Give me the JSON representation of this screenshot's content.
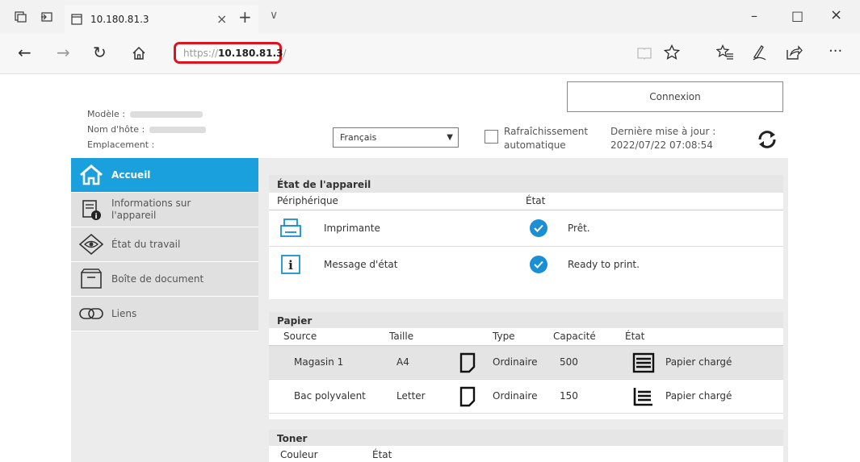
{
  "browser": {
    "tab_title": "10.180.81.3",
    "tab_close": "×",
    "new_tab": "+",
    "tab_menu": "∨",
    "minimize": "–",
    "maximize": "□",
    "close": "×",
    "back": "←",
    "forward": "→",
    "reload": "↻",
    "url_prefix": "https://",
    "url_host": "10.180.81.3",
    "url_suffix": "/",
    "more": "···"
  },
  "header": {
    "model_label": "Modèle :",
    "hostname_label": "Nom d'hôte :",
    "location_label": "Emplacement :",
    "login_button": "Connexion",
    "language": "Français",
    "auto_refresh_line1": "Rafraîchissement",
    "auto_refresh_line2": "automatique",
    "last_update_label": "Dernière mise à jour :",
    "last_update_value": "2022/07/22 07:08:54"
  },
  "sidebar": {
    "items": [
      {
        "label": "Accueil"
      },
      {
        "label": "Informations sur l'appareil"
      },
      {
        "label": "État du travail"
      },
      {
        "label": "Boîte de document"
      },
      {
        "label": "Liens"
      }
    ]
  },
  "device_status": {
    "title": "État de l'appareil",
    "col_device": "Périphérique",
    "col_status": "État",
    "rows": [
      {
        "name": "Imprimante",
        "status": "Prêt."
      },
      {
        "name": "Message d'état",
        "status": "Ready to print."
      }
    ]
  },
  "paper": {
    "title": "Papier",
    "cols": [
      "Source",
      "Taille",
      "Type",
      "Capacité",
      "État"
    ],
    "rows": [
      {
        "source": "Magasin 1",
        "size": "A4",
        "type": "Ordinaire",
        "capacity": "500",
        "status": "Papier chargé"
      },
      {
        "source": "Bac polyvalent",
        "size": "Letter",
        "type": "Ordinaire",
        "capacity": "150",
        "status": "Papier chargé"
      }
    ]
  },
  "toner": {
    "title": "Toner",
    "col_color": "Couleur",
    "col_status": "État"
  },
  "colors": {
    "accent": "#1aa0dc",
    "highlight": "#e0141e",
    "check": "#1a8fd4"
  }
}
